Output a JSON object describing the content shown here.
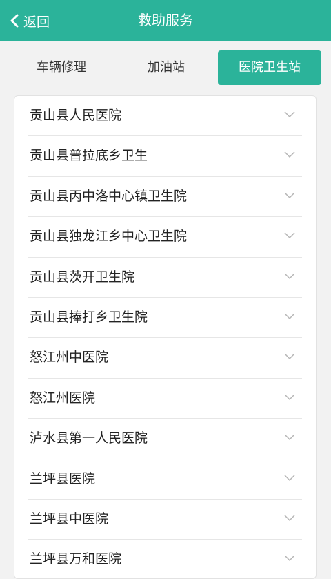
{
  "header": {
    "back_label": "返回",
    "title": "救助服务",
    "bg_color": "#2bb39a"
  },
  "tabs": [
    {
      "label": "车辆修理",
      "active": false
    },
    {
      "label": "加油站",
      "active": false
    },
    {
      "label": "医院卫生站",
      "active": true
    }
  ],
  "hospitals": [
    {
      "name": "贡山县人民医院"
    },
    {
      "name": "贡山县普拉底乡卫生"
    },
    {
      "name": "贡山县丙中洛中心镇卫生院"
    },
    {
      "name": "贡山县独龙江乡中心卫生院"
    },
    {
      "name": "贡山县茨开卫生院"
    },
    {
      "name": "贡山县捧打乡卫生院"
    },
    {
      "name": "怒江州中医院"
    },
    {
      "name": "怒江州医院"
    },
    {
      "name": "泸水县第一人民医院"
    },
    {
      "name": "兰坪县医院"
    },
    {
      "name": "兰坪县中医院"
    },
    {
      "name": "兰坪县万和医院"
    }
  ],
  "icons": {
    "back": "chevron-left-icon",
    "expand": "chevron-down-icon"
  }
}
